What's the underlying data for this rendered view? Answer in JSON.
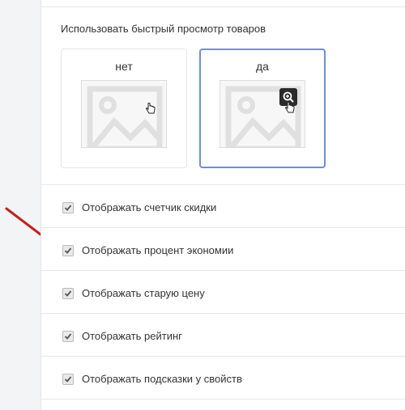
{
  "quick_view": {
    "title": "Использовать быстрый просмотр товаров",
    "options": [
      {
        "label": "нет",
        "selected": false,
        "icon": "image-placeholder-icon"
      },
      {
        "label": "да",
        "selected": true,
        "icon": "image-placeholder-icon",
        "badge_icon": "zoom-in-icon"
      }
    ]
  },
  "checkboxes": [
    {
      "label": "Отображать счетчик скидки",
      "checked": true
    },
    {
      "label": "Отображать процент экономии",
      "checked": true
    },
    {
      "label": "Отображать старую цену",
      "checked": true
    },
    {
      "label": "Отображать рейтинг",
      "checked": true
    },
    {
      "label": "Отображать подсказки у свойств",
      "checked": true
    }
  ],
  "annotation": {
    "arrow_color": "#c0231e",
    "arrow_target": "Отображать процент экономии"
  },
  "colors": {
    "selected_border": "#6a8fe0",
    "divider": "#e6e7ea",
    "panel_bg": "#ffffff",
    "page_bg": "#f3f4f6"
  }
}
